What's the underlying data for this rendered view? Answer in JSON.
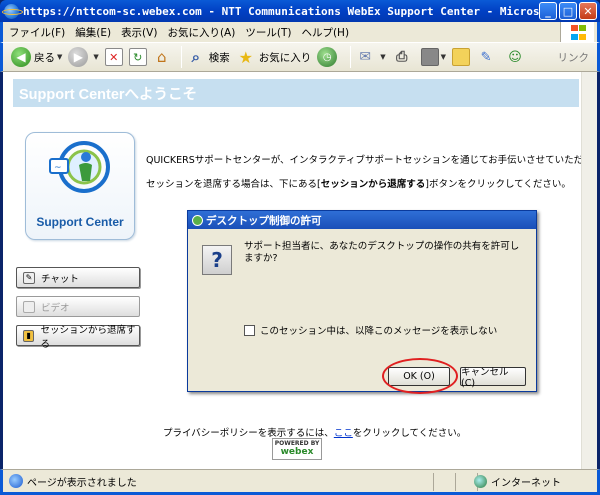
{
  "window": {
    "title": "https://nttcom-sc.webex.com - NTT Communications WebEx Support Center - Microsoft Internet Expl..."
  },
  "menu": [
    "ファイル(F)",
    "編集(E)",
    "表示(V)",
    "お気に入り(A)",
    "ツール(T)",
    "ヘルプ(H)"
  ],
  "toolbar": {
    "back": "戻る",
    "search": "検索",
    "favorites": "お気に入り",
    "links": "リンク"
  },
  "page": {
    "banner": "Support Centerへようこそ",
    "logo_text": "Support Center",
    "intro": "QUICKERSサポートセンターが、インタラクティブサポートセッションを通じてお手伝いさせていただきます。",
    "leave_prefix": "セッションを退席する場合は、下にある[",
    "leave_bold": "セッションから退席する",
    "leave_suffix": "]ボタンをクリックしてください。",
    "side_buttons": {
      "chat": "チャット",
      "video": "ビデオ",
      "leave": "セッションから退席する"
    },
    "privacy_prefix": "プライバシーポリシーを表示するには、",
    "privacy_link": "ここ",
    "privacy_suffix": "をクリックしてください。",
    "powered_by": "POWERED BY",
    "webex": "webex"
  },
  "dialog": {
    "title": "デスクトップ制御の許可",
    "message": "サポート担当者に、あなたのデスクトップの操作の共有を許可しますか?",
    "checkbox": "このセッション中は、以降このメッセージを表示しない",
    "ok": "OK (O)",
    "cancel": "キャンセル (C)"
  },
  "status": {
    "left": "ページが表示されました",
    "zone": "インターネット"
  },
  "colors": {
    "titlebar": "#0a5ad6",
    "banner": "#c6dff0",
    "highlight_ring": "#e02020"
  }
}
